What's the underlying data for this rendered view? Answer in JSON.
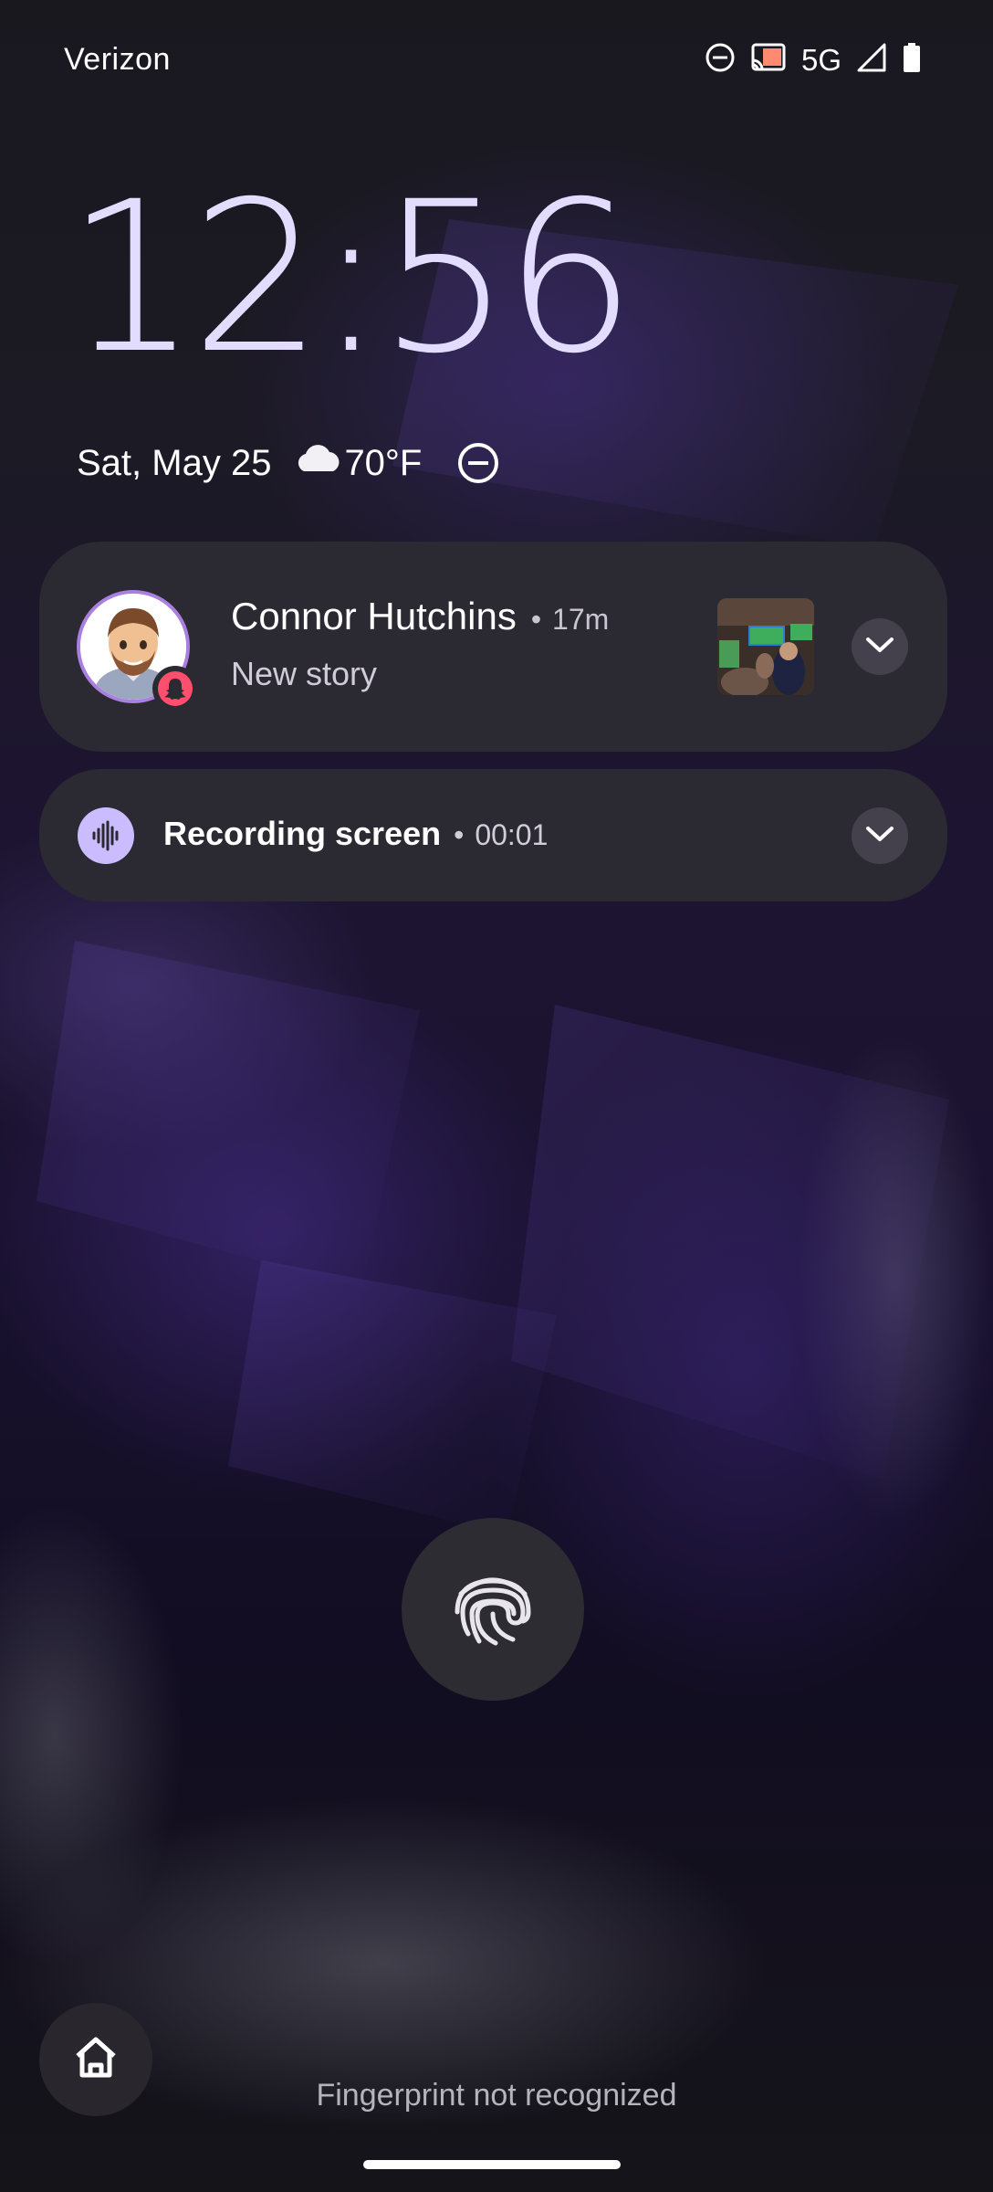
{
  "status_bar": {
    "carrier": "Verizon",
    "network": "5G",
    "icons": [
      "do-not-disturb-icon",
      "cast-icon",
      "signal-icon",
      "battery-icon"
    ]
  },
  "lock_screen": {
    "time": "12:56",
    "date": "Sat, May 25",
    "weather_icon": "cloud-icon",
    "temperature": "70°F",
    "status_icon": "do-not-disturb-icon"
  },
  "notifications": [
    {
      "app_icon": "snapchat-icon",
      "sender": "Connor Hutchins",
      "separator": "•",
      "time_ago": "17m",
      "text": "New story"
    },
    {
      "app_icon": "audio-waveform-icon",
      "title": "Recording screen",
      "separator": "•",
      "elapsed": "00:01"
    }
  ],
  "bottom": {
    "fingerprint_icon": "fingerprint-icon",
    "home_icon": "home-icon",
    "message": "Fingerprint not recognized"
  },
  "colors": {
    "clock": "#e2dcff",
    "card_background": "#2b2931",
    "avatar_ring": "#a97fe0",
    "recording_icon_bg": "#cbbcff",
    "snapchat_badge": "#ff4f6d"
  }
}
